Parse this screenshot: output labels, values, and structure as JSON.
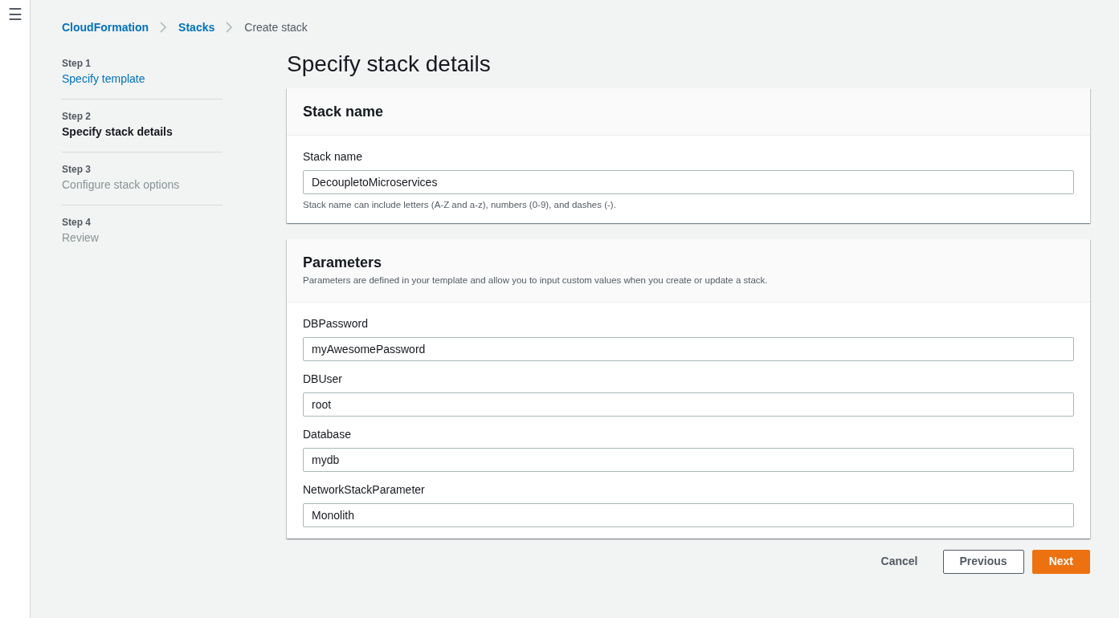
{
  "menu_button": "☰",
  "breadcrumb": [
    {
      "label": "CloudFormation",
      "current": false
    },
    {
      "label": "Stacks",
      "current": false
    },
    {
      "label": "Create stack",
      "current": true
    }
  ],
  "steps": [
    {
      "step": "Step 1",
      "label": "Specify template",
      "selected": false,
      "disabled": false
    },
    {
      "step": "Step 2",
      "label": "Specify stack details",
      "selected": true,
      "disabled": false
    },
    {
      "step": "Step 3",
      "label": "Configure stack options",
      "selected": false,
      "disabled": true
    },
    {
      "step": "Step 4",
      "label": "Review",
      "selected": false,
      "disabled": true
    }
  ],
  "title": "Specify stack details",
  "sections": [
    {
      "title": "Stack name",
      "fields": [
        {
          "label": "Stack name",
          "value": "DecoupletoMicroservices",
          "hint": "Stack name can include letters (A-Z and a-z), numbers (0-9), and dashes (-)."
        }
      ]
    },
    {
      "title": "Parameters",
      "description": "Parameters are defined in your template and allow you to input custom values when you create or update a stack.",
      "fields": [
        {
          "label": "DBPassword",
          "value": "myAwesomePassword"
        },
        {
          "label": "DBUser",
          "value": "root"
        },
        {
          "label": "Database",
          "value": "mydb"
        },
        {
          "label": "NetworkStackParameter",
          "value": "Monolith"
        }
      ]
    }
  ],
  "buttons": [
    {
      "label": "Cancel",
      "kind": "link"
    },
    {
      "label": "Previous",
      "kind": "normal"
    },
    {
      "label": "Next",
      "kind": "primary"
    }
  ]
}
